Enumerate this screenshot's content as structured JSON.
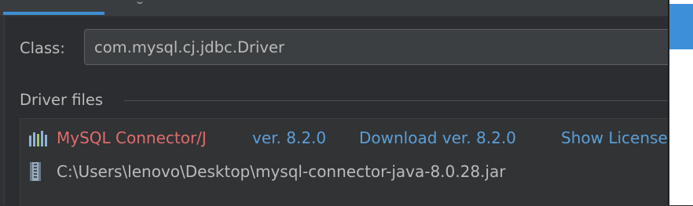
{
  "class_field": {
    "label": "Class:",
    "value": "com.mysql.cj.jdbc.Driver"
  },
  "driver_files": {
    "section_title": "Driver files",
    "library": {
      "name": "MySQL Connector/J",
      "version": "ver. 8.2.0",
      "download_link": "Download ver. 8.2.0",
      "license_link": "Show License",
      "icon": "library-icon"
    },
    "jar": {
      "path": "C:\\Users\\lenovo\\Desktop\\mysql-connector-java-8.0.28.jar",
      "icon": "jar-file-icon"
    }
  },
  "colors": {
    "accent": "#3d8fd1",
    "library_name": "#e06c6c",
    "link": "#5c9fd8",
    "background": "#2b2d30"
  }
}
